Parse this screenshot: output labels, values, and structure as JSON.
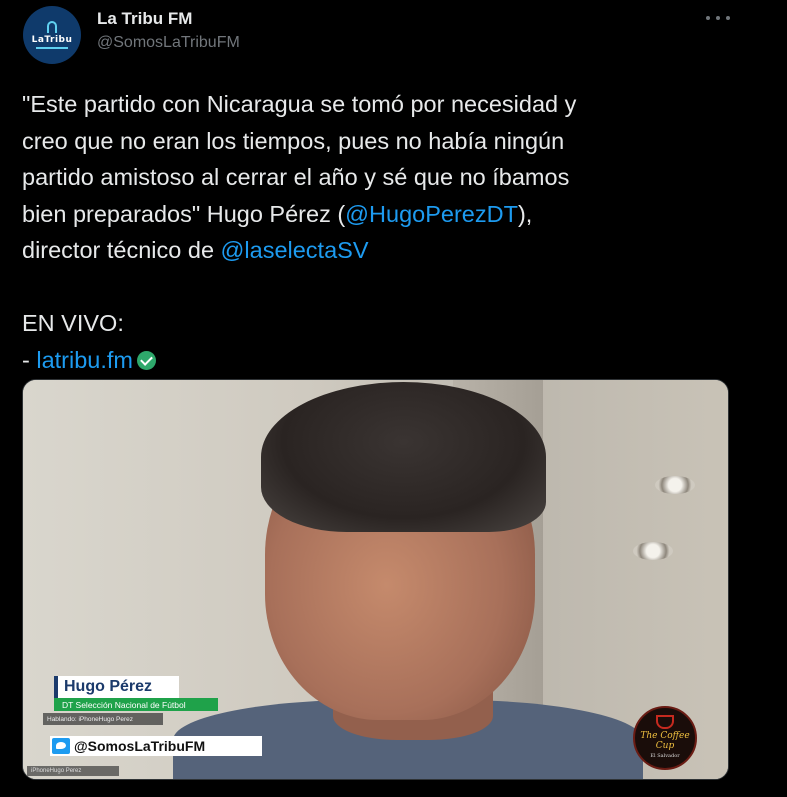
{
  "tweet": {
    "author": {
      "display_name": "La Tribu FM",
      "handle": "@SomosLaTribuFM",
      "avatar_text": "LaTribu"
    },
    "text_lines": [
      {
        "pre": "\"Este partido con Nicaragua se tomó por necesidad y",
        "mention": "",
        "post": ""
      },
      {
        "pre": "creo que no eran los tiempos, pues no había ningún",
        "mention": "",
        "post": ""
      },
      {
        "pre": "partido amistoso al cerrar el año y sé que no íbamos",
        "mention": "",
        "post": ""
      },
      {
        "pre": "bien preparados\" Hugo Pérez (",
        "mention": "@HugoPerezDT",
        "post": "),"
      },
      {
        "pre": "director técnico de ",
        "mention": "@laselectaSV",
        "post": ""
      },
      {
        "pre": "",
        "mention": "",
        "post": ""
      },
      {
        "pre": "EN VIVO:",
        "mention": "",
        "post": ""
      },
      {
        "pre": "- ",
        "mention": "latribu.fm",
        "post": ""
      }
    ]
  },
  "media": {
    "name_tag": "Hugo Pérez",
    "role_tag": "DT Selección Nacional de Fútbol",
    "speaking_chip": "Hablando: iPhoneHugo Perez",
    "twitter_handle": "@SomosLaTribuFM",
    "bottom_caption": "iPhoneHugo Perez",
    "coffee_logo_title": "The Coffee Cup",
    "coffee_logo_sub": "El Salvador"
  },
  "colors": {
    "background": "#000000",
    "text": "#e7e9ea",
    "secondary_text": "#71767b",
    "link": "#1d9bf0",
    "verified": "#2ea86b",
    "name_tag_blue": "#1b3a6b",
    "role_tag_green": "#1fa24a"
  },
  "icons": {
    "more": "more-horizontal-icon",
    "verified": "verified-check-icon",
    "twitter": "twitter-bird-icon"
  }
}
